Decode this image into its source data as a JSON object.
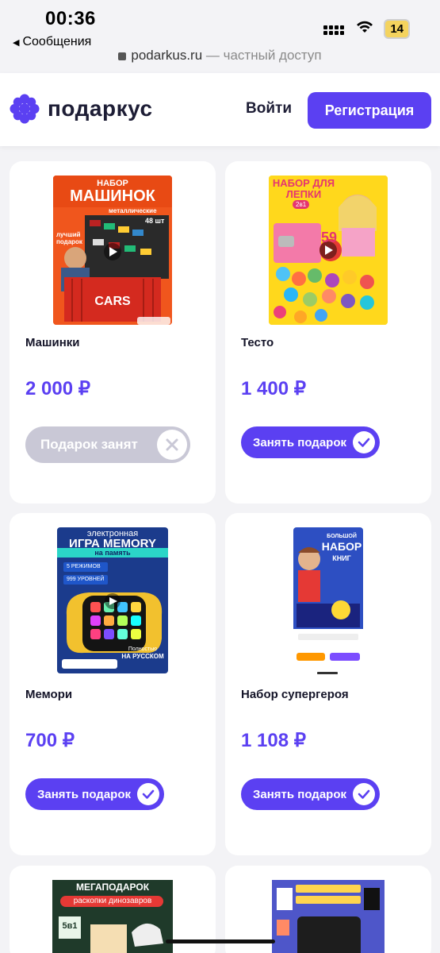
{
  "status": {
    "time": "00:36",
    "back_app": "Сообщения",
    "battery": "14"
  },
  "browser": {
    "domain": "podarkus.ru",
    "suffix": " — частный доступ"
  },
  "header": {
    "logo_text": "подаркус",
    "login": "Войти",
    "register": "Регистрация"
  },
  "colors": {
    "accent": "#5b40f2",
    "taken": "#c9c8d6"
  },
  "products": [
    {
      "title": "Машинки",
      "price": "2 000 ₽",
      "action": "Подарок занят",
      "taken": true,
      "photo_text": [
        "НАБОР",
        "МАШИНОК",
        "металлические",
        "48 шт",
        "лучший подарок",
        "CARS"
      ]
    },
    {
      "title": "Тесто",
      "price": "1 400 ₽",
      "action": "Занять подарок",
      "taken": false,
      "photo_text": [
        "НАБОР ДЛЯ",
        "ЛЕПКИ",
        "2в1",
        "59"
      ]
    },
    {
      "title": "Мемори",
      "price": "700 ₽",
      "action": "Занять подарок",
      "taken": false,
      "photo_text": [
        "электронная",
        "ИГРА MEMORY",
        "на память",
        "5 РЕЖИМОВ",
        "999 УРОВНЕЙ",
        "Полностью",
        "НА РУССКОМ"
      ]
    },
    {
      "title": "Набор супергероя",
      "price": "1 108 ₽",
      "action": "Занять подарок",
      "taken": false,
      "photo_text": [
        "БОЛЬШОЙ",
        "НАБОР",
        "КНИГ"
      ]
    }
  ],
  "partial_cards": [
    {
      "photo_text": [
        "МЕГАПОДАРОК",
        "раскопки динозавров",
        "5в1"
      ]
    },
    {
      "photo_text": []
    }
  ]
}
